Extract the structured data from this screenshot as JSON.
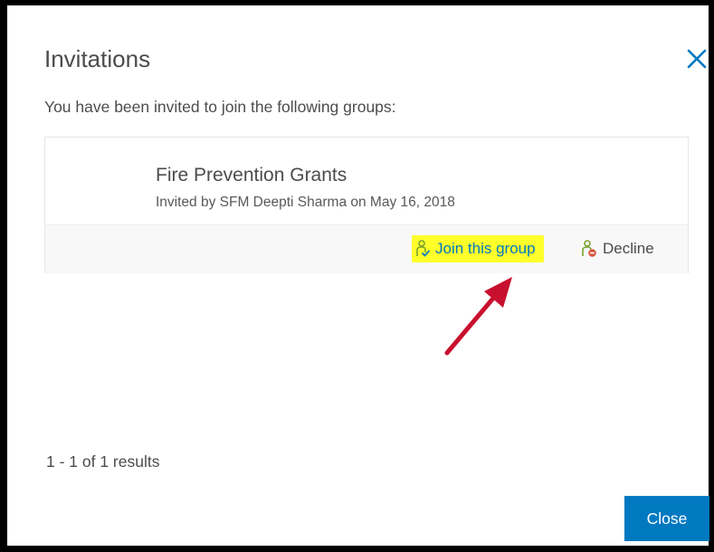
{
  "dialog": {
    "title": "Invitations",
    "subtitle": "You have been invited to join the following groups:",
    "close_icon": "close-x-icon",
    "accent_color": "#0079c1"
  },
  "invitations": [
    {
      "group_name": "Fire Prevention Grants",
      "invited_by": "Invited by SFM Deepti Sharma on May 16, 2018",
      "join_label": "Join this group",
      "join_icon": "user-join-icon",
      "join_highlight_color": "#ffff2a",
      "decline_label": "Decline",
      "decline_icon": "user-decline-icon"
    }
  ],
  "annotation": {
    "arrow_color": "#c8102e",
    "arrow_icon": "annotation-arrow"
  },
  "footer": {
    "results_text": "1 - 1 of 1 results",
    "close_label": "Close"
  }
}
